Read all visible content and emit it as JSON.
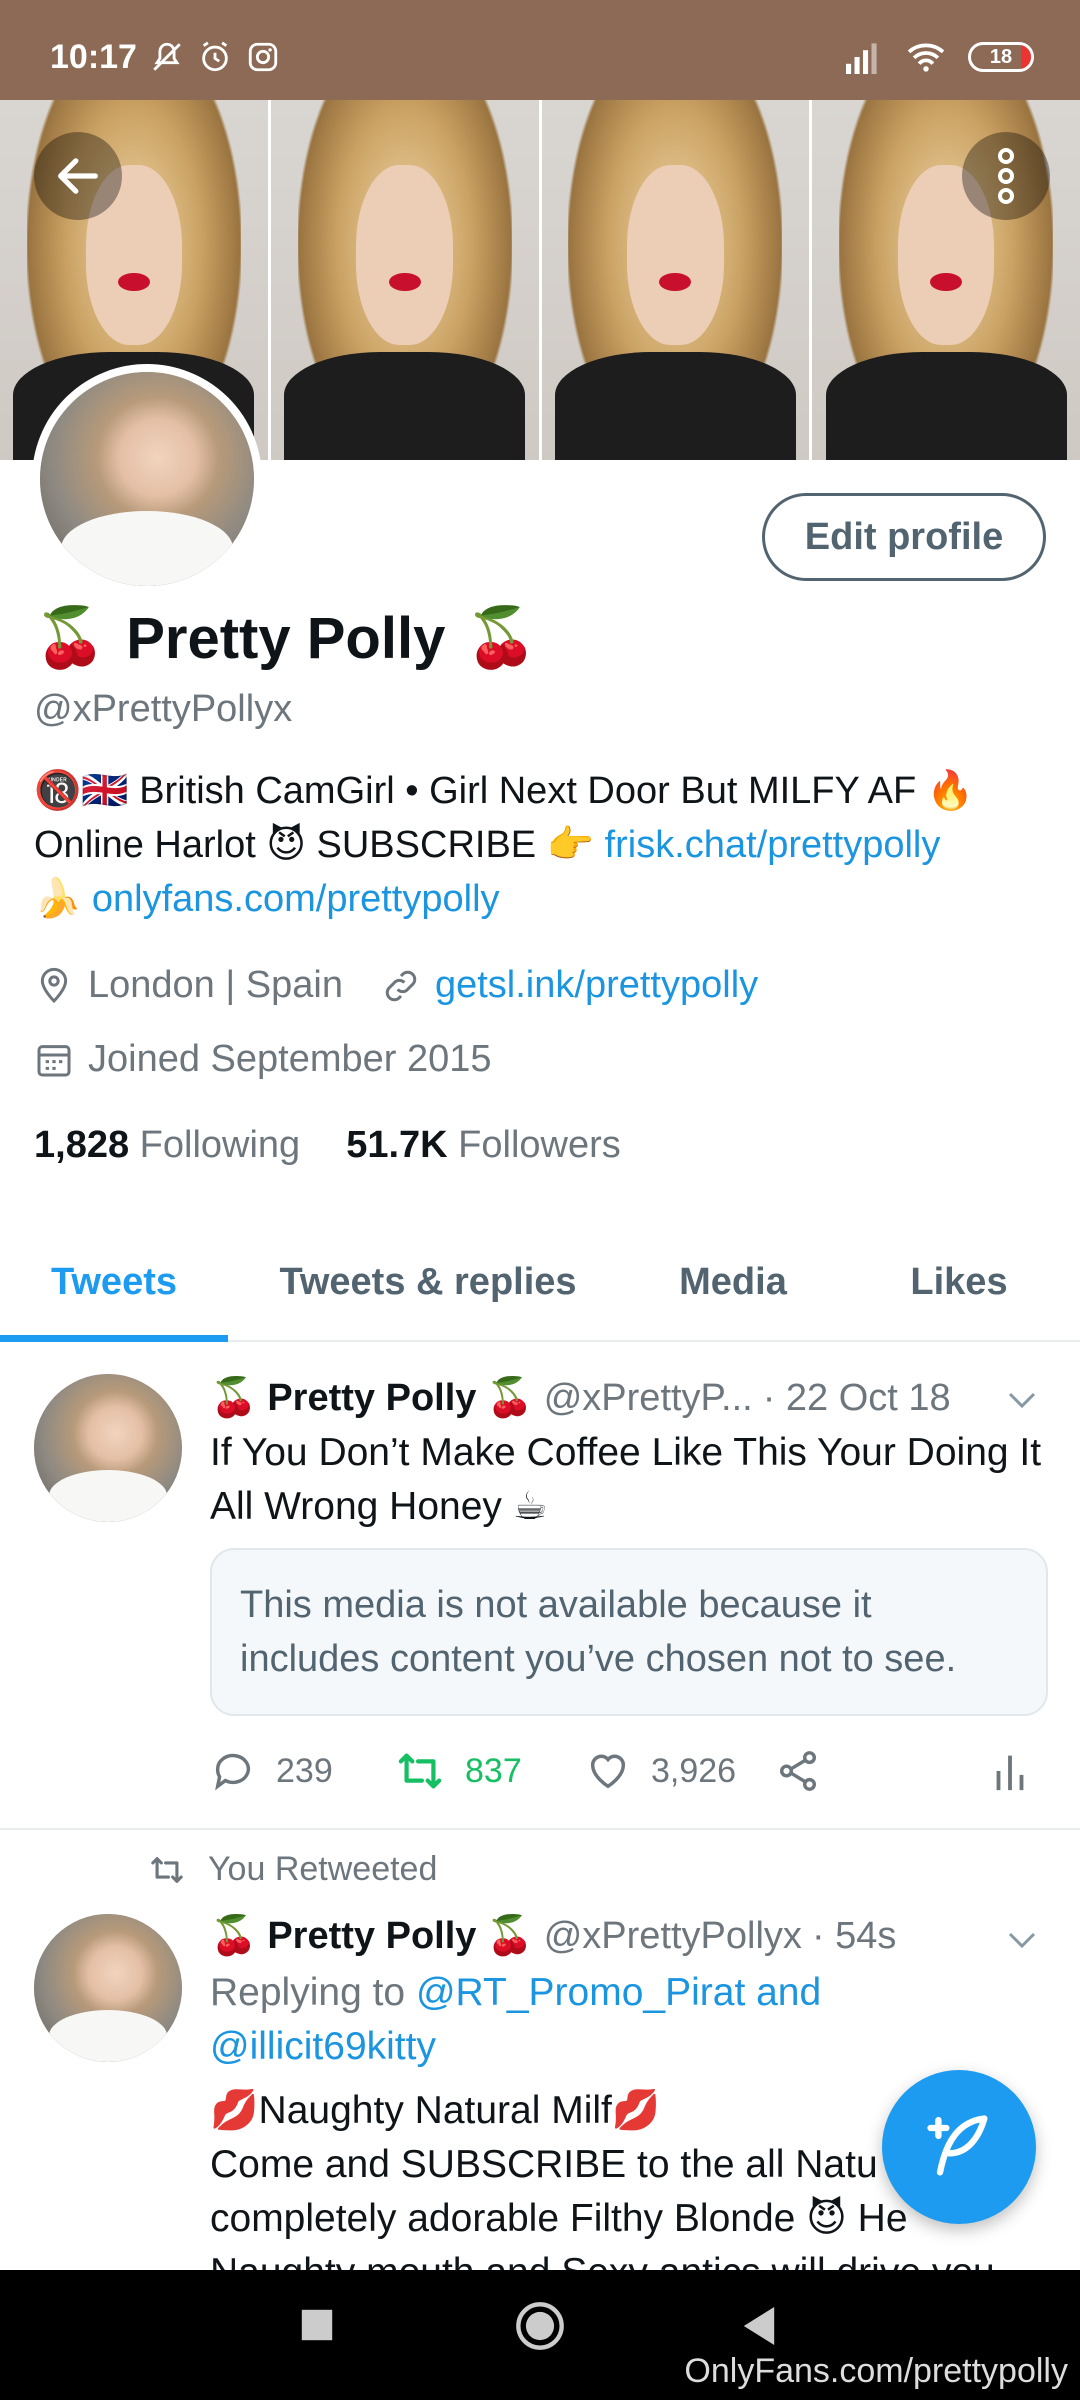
{
  "status_bar": {
    "time": "10:17",
    "battery": "18",
    "icons": [
      "mute-icon",
      "alarm-icon",
      "instagram-icon",
      "signal-icon",
      "wifi-icon",
      "battery-icon"
    ]
  },
  "profile": {
    "name": "Pretty Polly",
    "name_emoji": "🍒",
    "handle": "@xPrettyPollyx",
    "edit_button": "Edit profile",
    "bio_line1_emoji": "🔞🇬🇧",
    "bio_line1": "British CamGirl • Girl Next Door But MILFY AF",
    "bio_line1_end": "🔥",
    "bio_line2_a": "Online Harlot",
    "bio_line2_emoji1": "😈",
    "bio_line2_b": "SUBSCRIBE",
    "bio_line2_emoji2": "👉",
    "bio_link1": "frisk.chat/prettypolly",
    "bio_line3_emoji": "🍌",
    "bio_link2": "onlyfans.com/prettypolly",
    "location": "London | Spain",
    "website": "getsl.ink/prettypolly",
    "joined": "Joined September 2015",
    "following_count": "1,828",
    "following_label": "Following",
    "followers_count": "51.7K",
    "followers_label": "Followers"
  },
  "tabs": [
    {
      "label": "Tweets",
      "active": true
    },
    {
      "label": "Tweets & replies",
      "active": false
    },
    {
      "label": "Media",
      "active": false
    },
    {
      "label": "Likes",
      "active": false
    }
  ],
  "tweets": [
    {
      "name": "Pretty Polly",
      "handle": "@xPrettyP...",
      "time": "· 22 Oct 18",
      "text": "If You Don’t Make Coffee Like This Your Doing It All Wrong Honey ☕",
      "media_notice": "This media is not available because it includes content you’ve chosen not to see.",
      "replies": "239",
      "retweets": "837",
      "likes": "3,926"
    },
    {
      "retweeted_label": "You Retweeted",
      "name": "Pretty Polly",
      "handle": "@xPrettyPollyx",
      "time": "· 54s",
      "replying_prefix": "Replying to",
      "replying_to": "@RT_Promo_Pirat and",
      "replying_to2": "@illicit69kitty",
      "line1": "💋Naughty Natural Milf💋",
      "line2": "Come and SUBSCRIBE to the all Natu",
      "line3": "completely adorable Filthy Blonde 😈 He",
      "line4": "Naughty mouth and Sexy antics will drive you"
    }
  ],
  "watermark": "OnlyFans.com/prettypolly",
  "colors": {
    "accent": "#1d9bf0",
    "retweet_green": "#17bf63",
    "muted": "#6e767d"
  }
}
